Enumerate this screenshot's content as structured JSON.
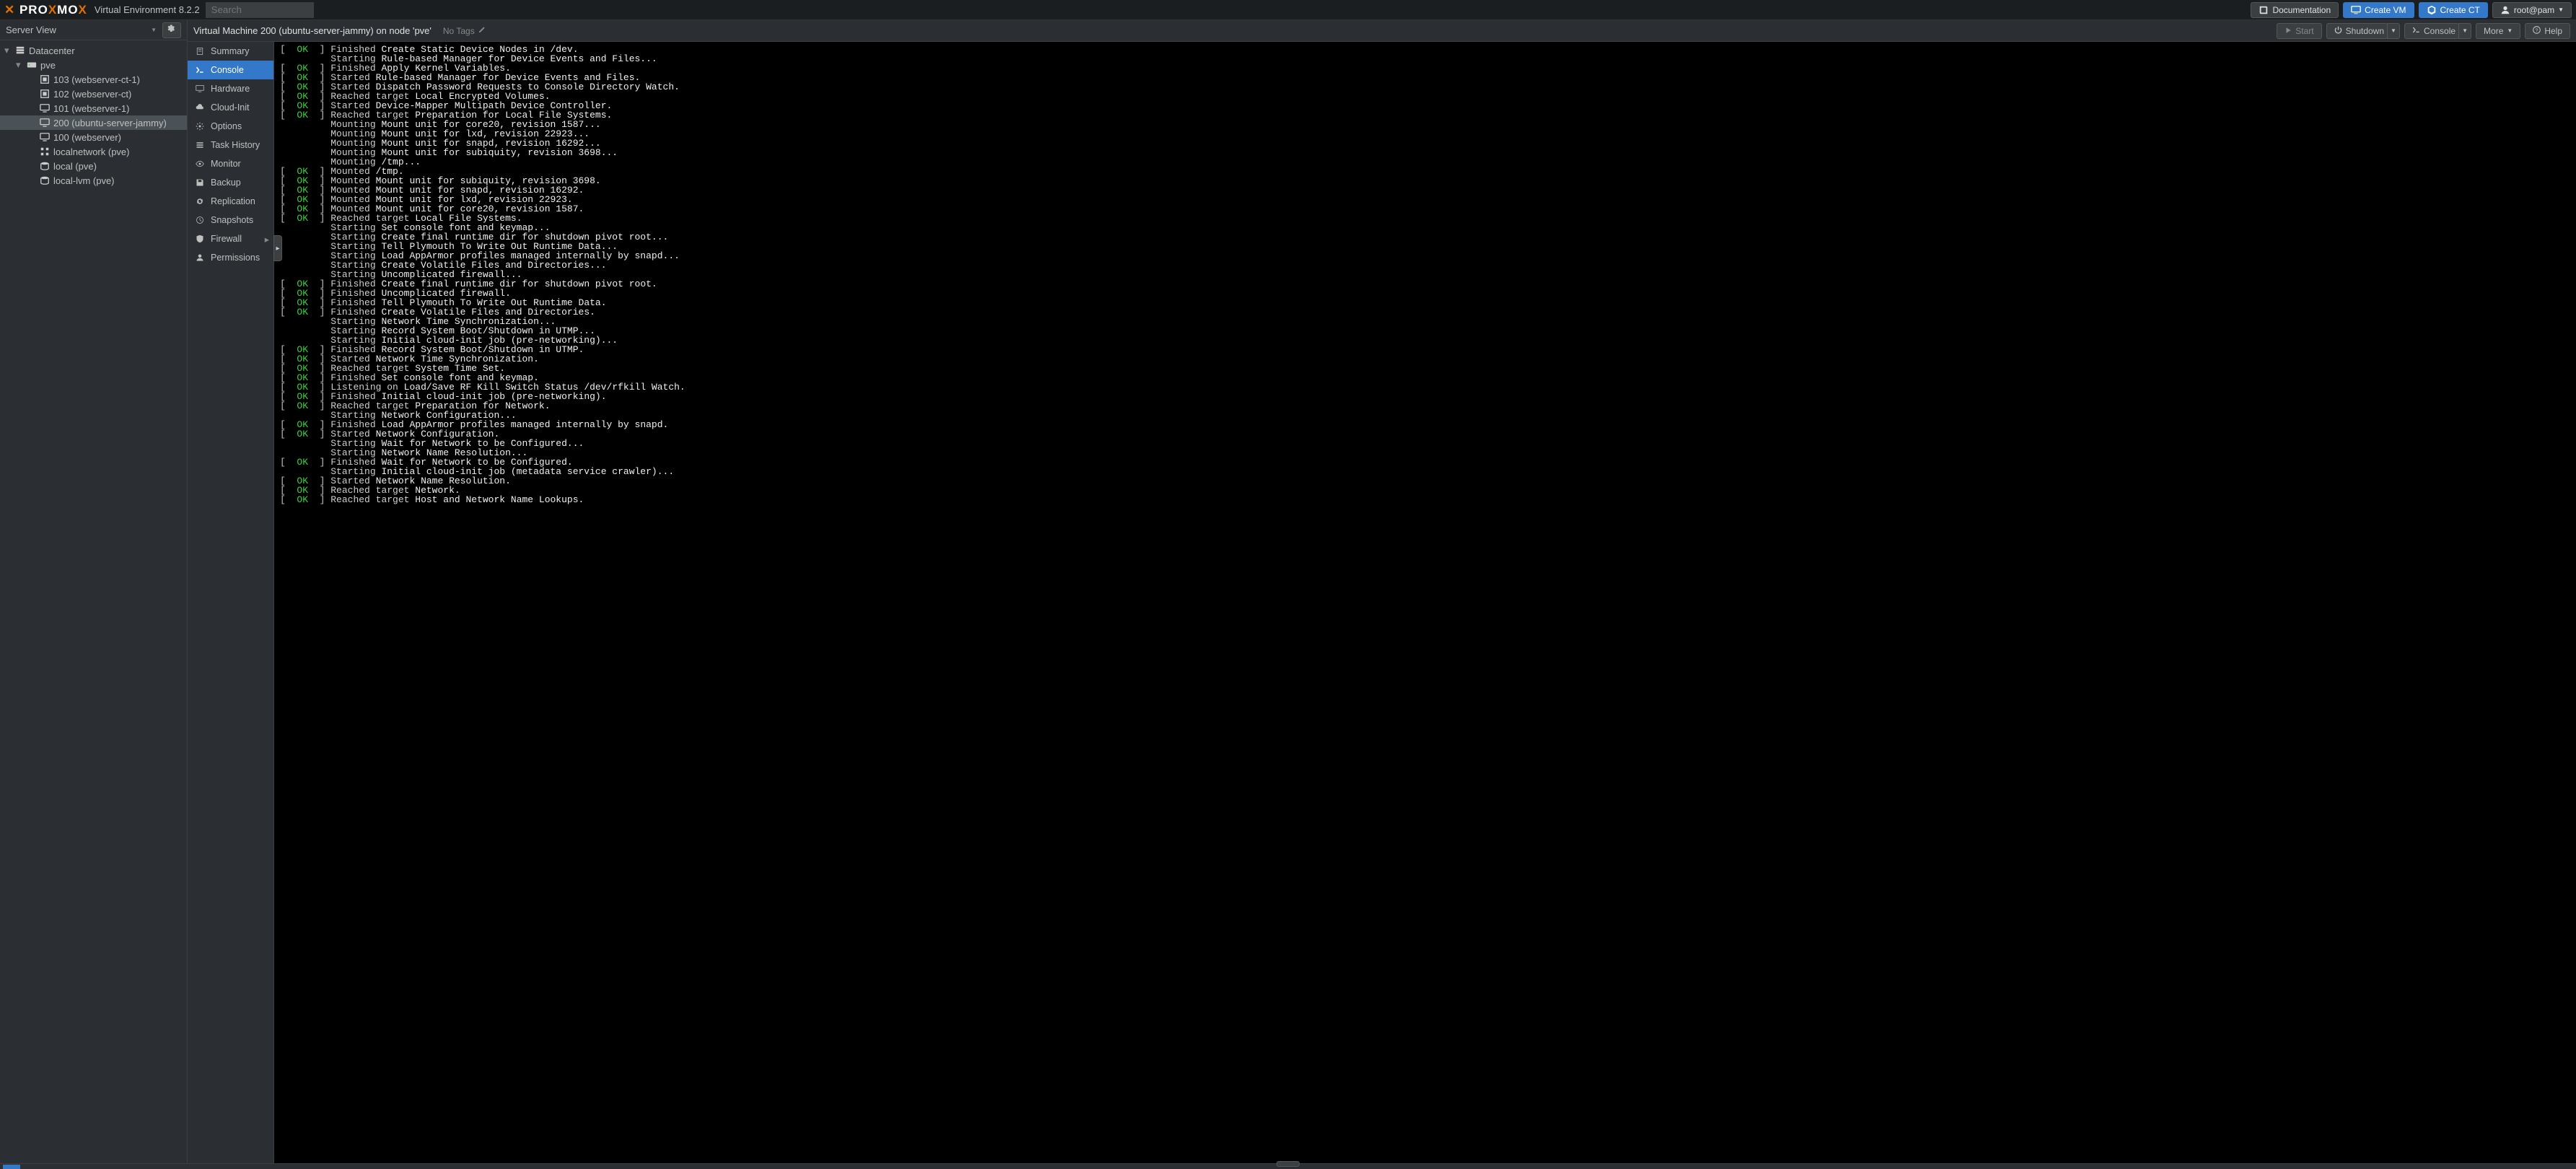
{
  "header": {
    "product": "PROXMOX",
    "title": "Virtual Environment 8.2.2",
    "search_placeholder": "Search",
    "buttons": {
      "documentation": "Documentation",
      "create_vm": "Create VM",
      "create_ct": "Create CT",
      "user": "root@pam"
    }
  },
  "tree": {
    "view_label": "Server View",
    "items": [
      {
        "label": "Datacenter",
        "kind": "datacenter",
        "indent": 0,
        "expanded": true
      },
      {
        "label": "pve",
        "kind": "node",
        "indent": 1,
        "expanded": true
      },
      {
        "label": "103 (webserver-ct-1)",
        "kind": "ct",
        "indent": 2
      },
      {
        "label": "102 (webserver-ct)",
        "kind": "ct",
        "indent": 2
      },
      {
        "label": "101 (webserver-1)",
        "kind": "vm",
        "indent": 2
      },
      {
        "label": "200 (ubuntu-server-jammy)",
        "kind": "vm",
        "indent": 2,
        "selected": true
      },
      {
        "label": "100 (webserver)",
        "kind": "vm",
        "indent": 2
      },
      {
        "label": "localnetwork (pve)",
        "kind": "sdn",
        "indent": 2
      },
      {
        "label": "local (pve)",
        "kind": "storage",
        "indent": 2
      },
      {
        "label": "local-lvm (pve)",
        "kind": "storage",
        "indent": 2
      }
    ]
  },
  "content_header": {
    "breadcrumb": "Virtual Machine 200 (ubuntu-server-jammy) on node 'pve'",
    "tags": "No Tags",
    "start": "Start",
    "shutdown": "Shutdown",
    "console": "Console",
    "more": "More",
    "help": "Help"
  },
  "sub_nav": [
    {
      "label": "Summary",
      "icon": "note"
    },
    {
      "label": "Console",
      "icon": "terminal",
      "active": true
    },
    {
      "label": "Hardware",
      "icon": "monitor"
    },
    {
      "label": "Cloud-Init",
      "icon": "cloud"
    },
    {
      "label": "Options",
      "icon": "gear"
    },
    {
      "label": "Task History",
      "icon": "list"
    },
    {
      "label": "Monitor",
      "icon": "eye"
    },
    {
      "label": "Backup",
      "icon": "save"
    },
    {
      "label": "Replication",
      "icon": "sync"
    },
    {
      "label": "Snapshots",
      "icon": "history"
    },
    {
      "label": "Firewall",
      "icon": "shield",
      "arrow": true
    },
    {
      "label": "Permissions",
      "icon": "user"
    }
  ],
  "console_lines": [
    {
      "status": "OK",
      "action": "Finished",
      "rest": "Create Static Device Nodes in /dev."
    },
    {
      "action": "Starting",
      "rest": "Rule-based Manager for Device Events and Files..."
    },
    {
      "status": "OK",
      "action": "Finished",
      "rest": "Apply Kernel Variables."
    },
    {
      "status": "OK",
      "action": "Started",
      "rest": "Rule-based Manager for Device Events and Files."
    },
    {
      "status": "OK",
      "action": "Started",
      "rest": "Dispatch Password Requests to Console Directory Watch."
    },
    {
      "status": "OK",
      "action": "Reached target",
      "rest": "Local Encrypted Volumes."
    },
    {
      "status": "OK",
      "action": "Started",
      "rest": "Device-Mapper Multipath Device Controller."
    },
    {
      "status": "OK",
      "action": "Reached target",
      "rest": "Preparation for Local File Systems."
    },
    {
      "action": "Mounting",
      "rest": "Mount unit for core20, revision 1587..."
    },
    {
      "action": "Mounting",
      "rest": "Mount unit for lxd, revision 22923..."
    },
    {
      "action": "Mounting",
      "rest": "Mount unit for snapd, revision 16292..."
    },
    {
      "action": "Mounting",
      "rest": "Mount unit for subiquity, revision 3698..."
    },
    {
      "action": "Mounting",
      "rest": "/tmp..."
    },
    {
      "status": "OK",
      "action": "Mounted",
      "rest": "/tmp."
    },
    {
      "status": "OK",
      "action": "Mounted",
      "rest": "Mount unit for subiquity, revision 3698."
    },
    {
      "status": "OK",
      "action": "Mounted",
      "rest": "Mount unit for snapd, revision 16292."
    },
    {
      "status": "OK",
      "action": "Mounted",
      "rest": "Mount unit for lxd, revision 22923."
    },
    {
      "status": "OK",
      "action": "Mounted",
      "rest": "Mount unit for core20, revision 1587."
    },
    {
      "status": "OK",
      "action": "Reached target",
      "rest": "Local File Systems."
    },
    {
      "action": "Starting",
      "rest": "Set console font and keymap..."
    },
    {
      "action": "Starting",
      "rest": "Create final runtime dir for shutdown pivot root..."
    },
    {
      "action": "Starting",
      "rest": "Tell Plymouth To Write Out Runtime Data..."
    },
    {
      "action": "Starting",
      "rest": "Load AppArmor profiles managed internally by snapd..."
    },
    {
      "action": "Starting",
      "rest": "Create Volatile Files and Directories..."
    },
    {
      "action": "Starting",
      "rest": "Uncomplicated firewall..."
    },
    {
      "status": "OK",
      "action": "Finished",
      "rest": "Create final runtime dir for shutdown pivot root."
    },
    {
      "status": "OK",
      "action": "Finished",
      "rest": "Uncomplicated firewall."
    },
    {
      "status": "OK",
      "action": "Finished",
      "rest": "Tell Plymouth To Write Out Runtime Data."
    },
    {
      "status": "OK",
      "action": "Finished",
      "rest": "Create Volatile Files and Directories."
    },
    {
      "action": "Starting",
      "rest": "Network Time Synchronization..."
    },
    {
      "action": "Starting",
      "rest": "Record System Boot/Shutdown in UTMP..."
    },
    {
      "action": "Starting",
      "rest": "Initial cloud-init job (pre-networking)..."
    },
    {
      "status": "OK",
      "action": "Finished",
      "rest": "Record System Boot/Shutdown in UTMP."
    },
    {
      "status": "OK",
      "action": "Started",
      "rest": "Network Time Synchronization."
    },
    {
      "status": "OK",
      "action": "Reached target",
      "rest": "System Time Set."
    },
    {
      "status": "OK",
      "action": "Finished",
      "rest": "Set console font and keymap."
    },
    {
      "status": "OK",
      "action": "Listening on",
      "rest": "Load/Save RF Kill Switch Status /dev/rfkill Watch."
    },
    {
      "status": "OK",
      "action": "Finished",
      "rest": "Initial cloud-init job (pre-networking)."
    },
    {
      "status": "OK",
      "action": "Reached target",
      "rest": "Preparation for Network."
    },
    {
      "action": "Starting",
      "rest": "Network Configuration..."
    },
    {
      "status": "OK",
      "action": "Finished",
      "rest": "Load AppArmor profiles managed internally by snapd."
    },
    {
      "status": "OK",
      "action": "Started",
      "rest": "Network Configuration."
    },
    {
      "action": "Starting",
      "rest": "Wait for Network to be Configured..."
    },
    {
      "action": "Starting",
      "rest": "Network Name Resolution..."
    },
    {
      "status": "OK",
      "action": "Finished",
      "rest": "Wait for Network to be Configured."
    },
    {
      "action": "Starting",
      "rest": "Initial cloud-init job (metadata service crawler)..."
    },
    {
      "status": "OK",
      "action": "Started",
      "rest": "Network Name Resolution."
    },
    {
      "status": "OK",
      "action": "Reached target",
      "rest": "Network."
    },
    {
      "status": "OK",
      "action": "Reached target",
      "rest": "Host and Network Name Lookups."
    }
  ]
}
